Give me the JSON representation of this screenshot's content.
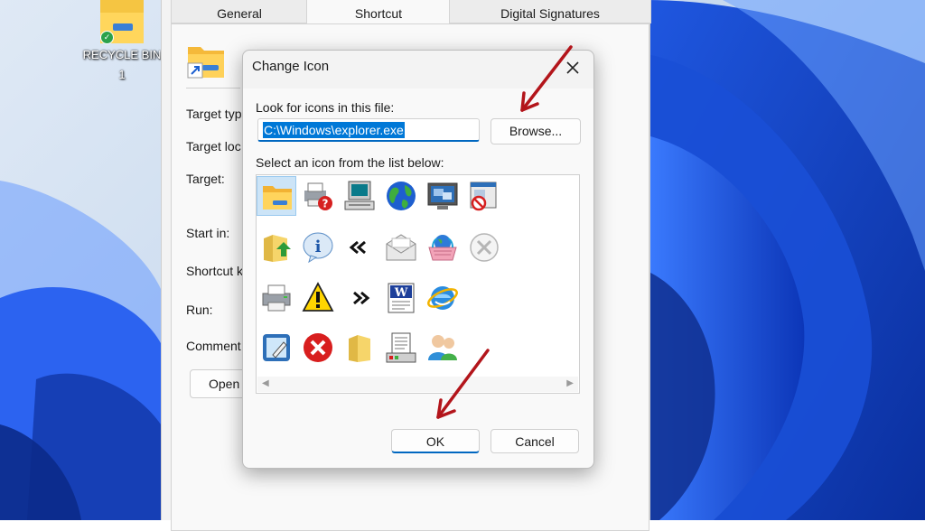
{
  "desktop": {
    "recycle_bin_label": "RECYCLE BIN\n1"
  },
  "properties": {
    "tabs": [
      {
        "label": "General"
      },
      {
        "label": "Shortcut"
      },
      {
        "label": "Digital Signatures"
      }
    ],
    "active_tab": "Shortcut",
    "fields": {
      "target_type": "Target typ",
      "target_location": "Target loc",
      "target": "Target:",
      "start_in": "Start in:",
      "shortcut_key": "Shortcut k",
      "run": "Run:",
      "comment": "Comment"
    },
    "open_button": "Open"
  },
  "dialog": {
    "title": "Change Icon",
    "look_label": "Look for icons in this file:",
    "path_value": "C:\\Windows\\explorer.exe",
    "browse_label": "Browse...",
    "select_label": "Select an icon from the list below:",
    "ok_label": "OK",
    "cancel_label": "Cancel",
    "icons": [
      {
        "name": "folder-icon",
        "selected": true
      },
      {
        "name": "printer-help-icon"
      },
      {
        "name": "computer-icon"
      },
      {
        "name": "globe-icon"
      },
      {
        "name": "monitor-windows-icon"
      },
      {
        "name": "window-blocked-icon"
      },
      {
        "name": "folder-up-arrow-icon"
      },
      {
        "name": "info-bubble-icon"
      },
      {
        "name": "rewind-icon"
      },
      {
        "name": "envelope-icon"
      },
      {
        "name": "basket-globe-icon"
      },
      {
        "name": "circle-x-icon"
      },
      {
        "name": "printer-icon"
      },
      {
        "name": "warning-icon"
      },
      {
        "name": "fast-forward-icon"
      },
      {
        "name": "word-document-icon"
      },
      {
        "name": "internet-explorer-icon"
      },
      {
        "name": "tablet-pen-icon"
      },
      {
        "name": "red-x-icon"
      },
      {
        "name": "folder-plain-icon"
      },
      {
        "name": "document-list-icon"
      },
      {
        "name": "users-icon"
      }
    ]
  },
  "colors": {
    "accent": "#0067c0",
    "selection": "#0078d7",
    "annotation_arrow": "#b3151b"
  }
}
